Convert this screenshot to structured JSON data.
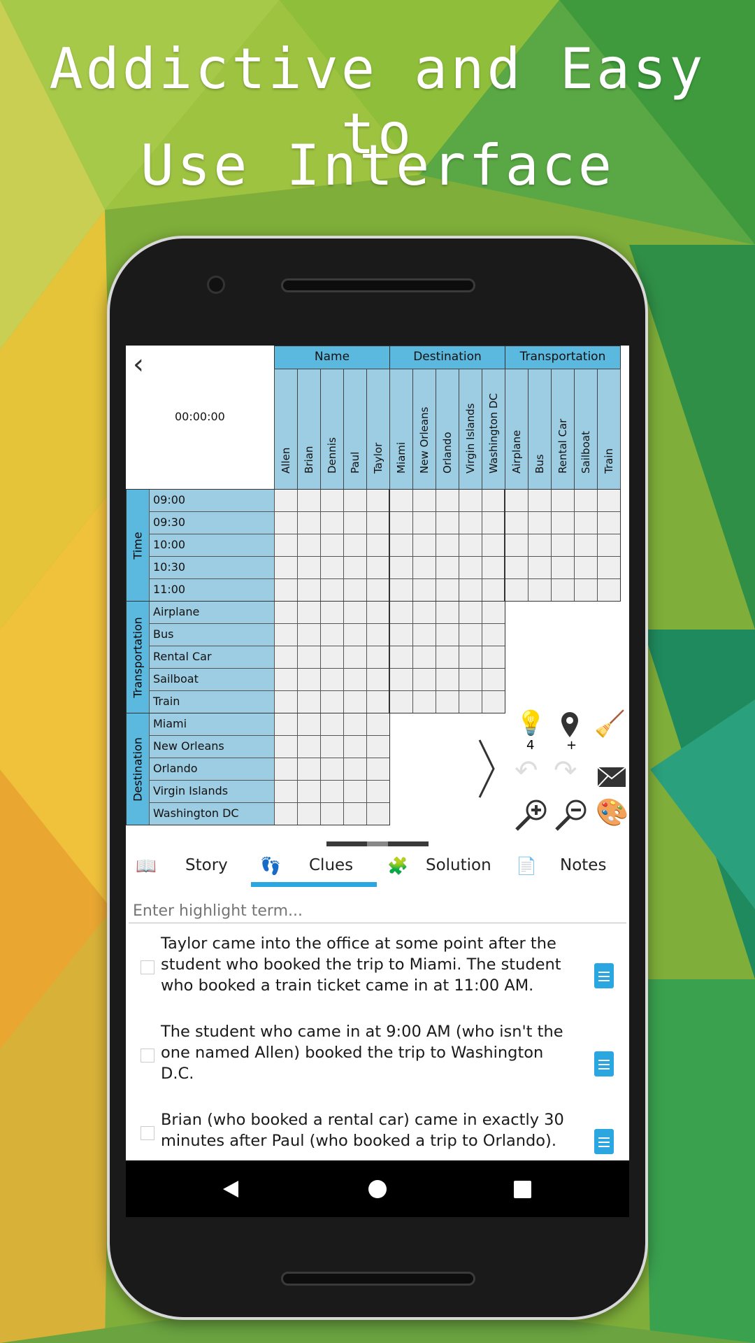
{
  "headline": {
    "line1": "Addictive and Easy to",
    "line2": "Use Interface"
  },
  "grid": {
    "timer": "00:00:00",
    "groups": [
      "Name",
      "Destination",
      "Transportation"
    ],
    "columns": [
      "Allen",
      "Brian",
      "Dennis",
      "Paul",
      "Taylor",
      "Miami",
      "New Orleans",
      "Orlando",
      "Virgin Islands",
      "Washington DC",
      "Airplane",
      "Bus",
      "Rental Car",
      "Sailboat",
      "Train"
    ],
    "row_groups": [
      {
        "label": "Time",
        "rows": [
          "09:00",
          "09:30",
          "10:00",
          "10:30",
          "11:00"
        ],
        "cols": 15
      },
      {
        "label": "Transportation",
        "rows": [
          "Airplane",
          "Bus",
          "Rental Car",
          "Sailboat",
          "Train"
        ],
        "cols": 10
      },
      {
        "label": "Destination",
        "rows": [
          "Miami",
          "New Orleans",
          "Orlando",
          "Virgin Islands",
          "Washington DC"
        ],
        "cols": 5
      }
    ]
  },
  "tools": {
    "hint_count": "4",
    "marker_label": "+"
  },
  "tabs": [
    {
      "label": "Story",
      "icon": "book-icon"
    },
    {
      "label": "Clues",
      "icon": "footprint-icon",
      "active": true
    },
    {
      "label": "Solution",
      "icon": "puzzle-icon"
    },
    {
      "label": "Notes",
      "icon": "note-icon"
    }
  ],
  "search": {
    "placeholder": "Enter highlight term..."
  },
  "clues": [
    [
      "Taylor came into the office at some point after the",
      "student who booked the trip to Miami. The student",
      "who booked a train ticket came in at 11:00 AM."
    ],
    [
      "The student who came in at 9:00 AM (who isn't the",
      "one named Allen) booked the trip to Washington",
      "D.C."
    ],
    [
      "Brian (who booked a rental car) came in exactly 30",
      "minutes after Paul (who booked a trip to Orlando)."
    ]
  ],
  "colors": {
    "header": "#5bb8de",
    "label": "#9ccde3",
    "cell": "#efefef",
    "accent": "#2aa6e0"
  }
}
